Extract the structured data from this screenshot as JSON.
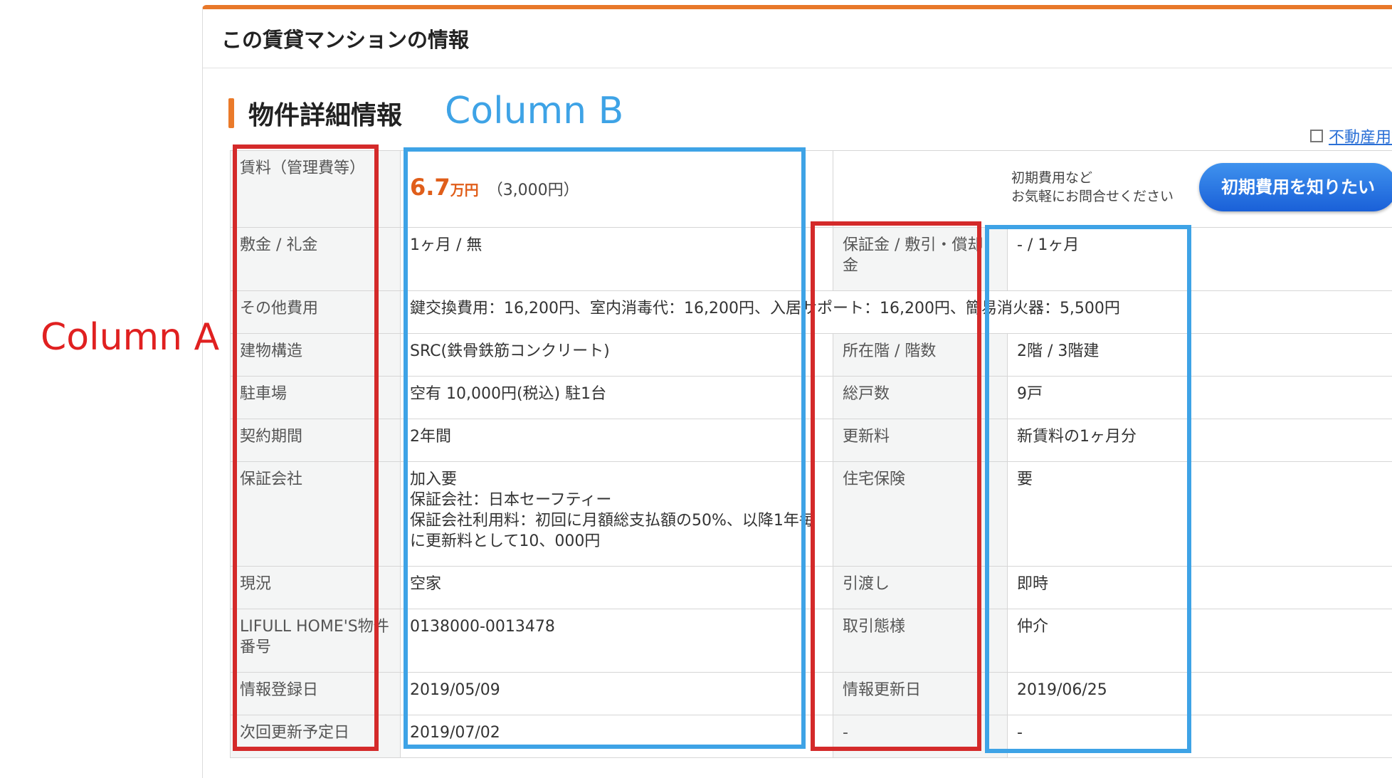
{
  "panel": {
    "title": "この賃貸マンションの情報",
    "section_title": "物件詳細情報",
    "glossary_link": "不動産用語"
  },
  "rent": {
    "label": "賃料（管理費等）",
    "amount": "6.7",
    "unit": "万円",
    "management_fee": "（3,000円）",
    "inquiry_line1": "初期費用など",
    "inquiry_line2": "お気軽にお問合せください",
    "inquiry_button": "初期費用を知りたい"
  },
  "rows": [
    {
      "l1": "敷金 / 礼金",
      "v1": "1ヶ月 / 無",
      "l2": "保証金 / 敷引・償却金",
      "v2": "- / 1ヶ月"
    },
    {
      "l1": "建物構造",
      "v1": "SRC(鉄骨鉄筋コンクリート)",
      "l2": "所在階 / 階数",
      "v2": "2階 / 3階建"
    },
    {
      "l1": "駐車場",
      "v1": "空有 10,000円(税込) 駐1台",
      "l2": "総戸数",
      "v2": "9戸"
    },
    {
      "l1": "契約期間",
      "v1": "2年間",
      "l2": "更新料",
      "v2": "新賃料の1ヶ月分"
    },
    {
      "l1": "現況",
      "v1": "空家",
      "l2": "引渡し",
      "v2": "即時"
    },
    {
      "l1": "LIFULL HOME'S物件番号",
      "v1": "0138000-0013478",
      "l2": "取引態様",
      "v2": "仲介"
    },
    {
      "l1": "情報登録日",
      "v1": "2019/05/09",
      "l2": "情報更新日",
      "v2": "2019/06/25"
    },
    {
      "l1": "次回更新予定日",
      "v1": "2019/07/02",
      "l2": "-",
      "v2": "-"
    }
  ],
  "other_fees": {
    "label": "その他費用",
    "value": "鍵交換費用：16,200円、室内消毒代：16,200円、入居サポート：16,200円、簡易消火器：5,500円"
  },
  "guarantee": {
    "label": "保証会社",
    "line1": "加入要",
    "line2": "保証会社：日本セーフティー",
    "line3": "保証会社利用料：初回に月額総支払額の50%、以降1年毎に更新料として10、000円",
    "l2": "住宅保険",
    "v2": "要"
  },
  "annotations": {
    "column_a": "Column A",
    "column_b": "Column B"
  }
}
